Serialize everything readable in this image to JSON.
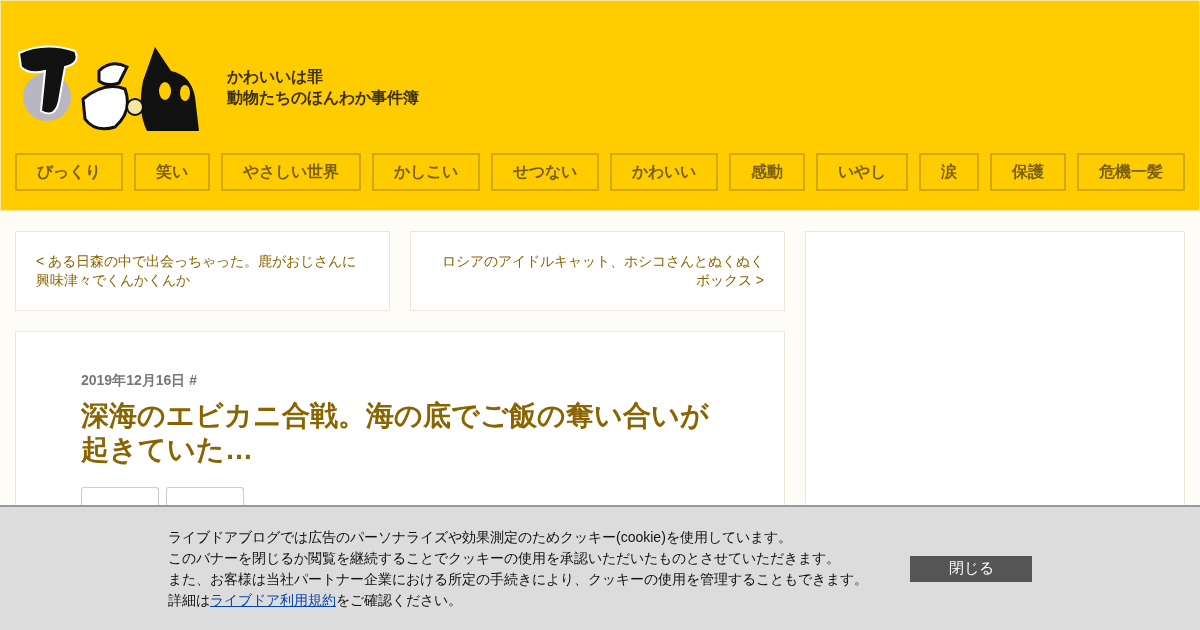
{
  "header": {
    "tagline": [
      "かわいいは罪",
      "動物たちのほんわか事件簿"
    ],
    "nav": [
      "びっくり",
      "笑い",
      "やさしい世界",
      "かしこい",
      "せつない",
      "かわいい",
      "感動",
      "いやし",
      "涙",
      "保護",
      "危機一髪"
    ]
  },
  "pager": {
    "prev": "< ある日森の中で出会っちゃった。鹿がおじさんに興味津々でくんかくんか",
    "next": "ロシアのアイドルキャット、ホシコさんとぬくぬくボックス >"
  },
  "article": {
    "date": "2019年12月16日",
    "permalink": "#",
    "title": "深海のエビカニ合戦。海の底でご飯の奪い合いが起きていた…",
    "tags": [
      {
        "kind": "tag"
      },
      {
        "kind": "tag"
      }
    ]
  },
  "cookie_banner": {
    "lines": [
      "ライブドアブログでは広告のパーソナライズや効果測定のためクッキー(cookie)を使用しています。",
      "このバナーを閉じるか閲覧を継続することでクッキーの使用を承認いただいたものとさせていただきます。",
      "また、お客様は当社パートナー企業における所定の手続きにより、クッキーの使用を管理することもできます。"
    ],
    "last_line": {
      "before": "詳細は",
      "link": "ライブドア利用規約",
      "after": "をご確認ください。"
    },
    "button": "閉じる"
  }
}
